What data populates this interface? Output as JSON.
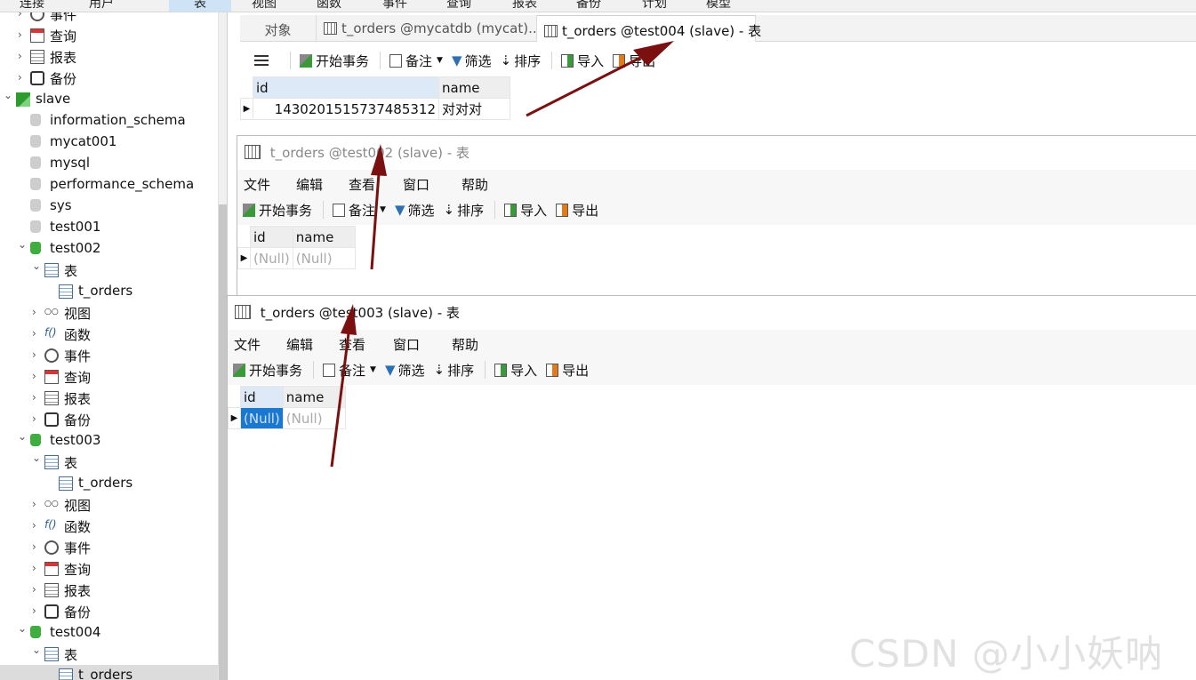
{
  "top_menu": [
    "连接",
    "用户",
    "表",
    "视图",
    "函数",
    "事件",
    "查询",
    "报表",
    "备份",
    "计划",
    "模型"
  ],
  "tree": [
    {
      "label": "事件",
      "icon": "clock-icon",
      "indent": 1,
      "expand": "collapsed"
    },
    {
      "label": "查询",
      "icon": "query-icon",
      "indent": 1,
      "expand": "collapsed"
    },
    {
      "label": "报表",
      "icon": "report-icon",
      "indent": 1,
      "expand": "collapsed"
    },
    {
      "label": "备份",
      "icon": "backup-icon",
      "indent": 1,
      "expand": "collapsed"
    },
    {
      "label": "slave",
      "icon": "connection-icon",
      "indent": 0,
      "expand": "expanded"
    },
    {
      "label": "information_schema",
      "icon": "database-gray-icon",
      "indent": 1,
      "expand": "none"
    },
    {
      "label": "mycat001",
      "icon": "database-gray-icon",
      "indent": 1,
      "expand": "none"
    },
    {
      "label": "mysql",
      "icon": "database-gray-icon",
      "indent": 1,
      "expand": "none"
    },
    {
      "label": "performance_schema",
      "icon": "database-gray-icon",
      "indent": 1,
      "expand": "none"
    },
    {
      "label": "sys",
      "icon": "database-gray-icon",
      "indent": 1,
      "expand": "none"
    },
    {
      "label": "test001",
      "icon": "database-gray-icon",
      "indent": 1,
      "expand": "none"
    },
    {
      "label": "test002",
      "icon": "database-green-icon",
      "indent": 1,
      "expand": "expanded"
    },
    {
      "label": "表",
      "icon": "table-group-icon",
      "indent": 2,
      "expand": "expanded"
    },
    {
      "label": "t_orders",
      "icon": "table-icon",
      "indent": 3,
      "expand": "none"
    },
    {
      "label": "视图",
      "icon": "view-icon",
      "indent": 2,
      "expand": "collapsed"
    },
    {
      "label": "函数",
      "icon": "function-icon",
      "indent": 2,
      "expand": "collapsed"
    },
    {
      "label": "事件",
      "icon": "clock-icon",
      "indent": 2,
      "expand": "collapsed"
    },
    {
      "label": "查询",
      "icon": "query-icon",
      "indent": 2,
      "expand": "collapsed"
    },
    {
      "label": "报表",
      "icon": "report-icon",
      "indent": 2,
      "expand": "collapsed"
    },
    {
      "label": "备份",
      "icon": "backup-icon",
      "indent": 2,
      "expand": "collapsed"
    },
    {
      "label": "test003",
      "icon": "database-green-icon",
      "indent": 1,
      "expand": "expanded"
    },
    {
      "label": "表",
      "icon": "table-group-icon",
      "indent": 2,
      "expand": "expanded"
    },
    {
      "label": "t_orders",
      "icon": "table-icon",
      "indent": 3,
      "expand": "none"
    },
    {
      "label": "视图",
      "icon": "view-icon",
      "indent": 2,
      "expand": "collapsed"
    },
    {
      "label": "函数",
      "icon": "function-icon",
      "indent": 2,
      "expand": "collapsed"
    },
    {
      "label": "事件",
      "icon": "clock-icon",
      "indent": 2,
      "expand": "collapsed"
    },
    {
      "label": "查询",
      "icon": "query-icon",
      "indent": 2,
      "expand": "collapsed"
    },
    {
      "label": "报表",
      "icon": "report-icon",
      "indent": 2,
      "expand": "collapsed"
    },
    {
      "label": "备份",
      "icon": "backup-icon",
      "indent": 2,
      "expand": "collapsed"
    },
    {
      "label": "test004",
      "icon": "database-green-icon",
      "indent": 1,
      "expand": "expanded"
    },
    {
      "label": "表",
      "icon": "table-group-icon",
      "indent": 2,
      "expand": "expanded"
    },
    {
      "label": "t_orders",
      "icon": "table-icon",
      "indent": 3,
      "expand": "none",
      "selected": true
    }
  ],
  "tabs": [
    {
      "label": "对象",
      "active": false
    },
    {
      "label": "t_orders @mycatdb (mycat)...",
      "active": false
    },
    {
      "label": "t_orders @test004 (slave) - 表",
      "active": true
    }
  ],
  "toolbar": {
    "begin_transaction": "开始事务",
    "memo": "备注",
    "filter": "筛选",
    "sort": "排序",
    "import": "导入",
    "export": "导出"
  },
  "menus": {
    "file": "文件",
    "edit": "编辑",
    "view": "查看",
    "window": "窗口",
    "help": "帮助"
  },
  "main_grid": {
    "columns": [
      "id",
      "name"
    ],
    "rows": [
      [
        "1430201515737485312",
        "对对对"
      ]
    ]
  },
  "win_test002": {
    "title": "t_orders @test002 (slave) - 表",
    "columns": [
      "id",
      "name"
    ],
    "rows": [
      [
        "(Null)",
        "(Null)"
      ]
    ]
  },
  "win_test003": {
    "title": "t_orders @test003 (slave) - 表",
    "columns": [
      "id",
      "name"
    ],
    "rows": [
      [
        "(Null)",
        "(Null)"
      ]
    ]
  },
  "watermark": "CSDN @小小妖呐",
  "colors": {
    "arrow": "#7b1010",
    "selection": "#1b78d0",
    "db_green": "#3fae3f"
  }
}
